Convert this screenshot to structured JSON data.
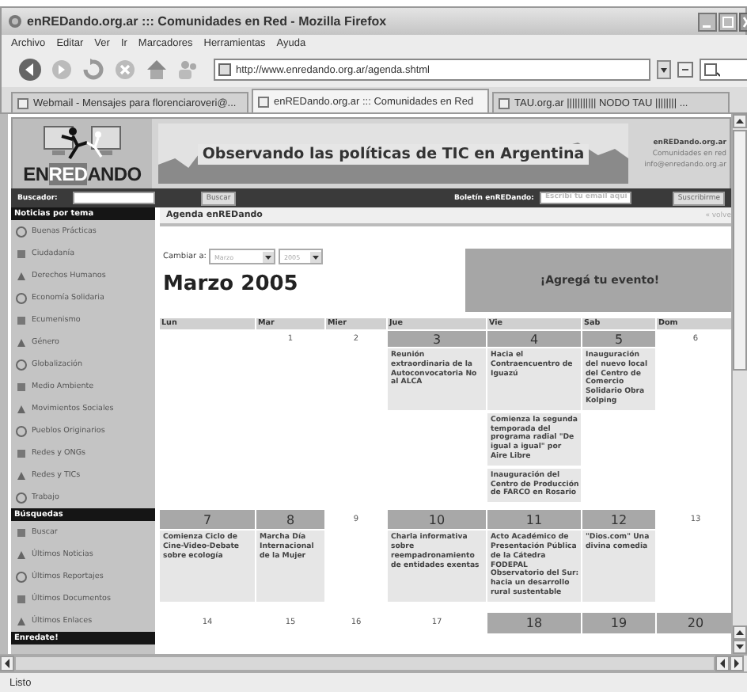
{
  "window": {
    "title": "enREDando.org.ar ::: Comunidades en Red - Mozilla Firefox"
  },
  "menu": [
    "Archivo",
    "Editar",
    "Ver",
    "Ir",
    "Marcadores",
    "Herramientas",
    "Ayuda"
  ],
  "toolbar": {
    "url": "http://www.enredando.org.ar/agenda.shtml"
  },
  "tabs": [
    {
      "label": "Webmail - Mensajes para florenciaroveri@...",
      "selected": false
    },
    {
      "label": "enREDando.org.ar ::: Comunidades en Red",
      "selected": true
    },
    {
      "label": "TAU.org.ar ||||||||||| NODO TAU |||||||| ...",
      "selected": false
    }
  ],
  "site_header": {
    "logo": [
      "EN",
      "RED",
      "ANDO"
    ],
    "banner": "Observando las políticas de TIC en Argentina",
    "info": [
      "enREDando.org.ar",
      "Comunidades en red",
      "info@enredando.org.ar"
    ]
  },
  "search_bar": {
    "search": {
      "label": "Buscador:",
      "button": "Buscar"
    },
    "newsletter": {
      "label": "Boletín enREDando:",
      "placeholder": "Escribí tu email aquí",
      "button": "Suscribirme"
    }
  },
  "sidebar": {
    "sections": [
      {
        "title": "Noticias por tema",
        "items": [
          {
            "label": "Buenas Prácticas"
          },
          {
            "label": "Ciudadanía"
          },
          {
            "label": "Derechos Humanos"
          },
          {
            "label": "Economía Solidaria"
          },
          {
            "label": "Ecumenismo"
          },
          {
            "label": "Género"
          },
          {
            "label": "Globalización"
          },
          {
            "label": "Medio Ambiente"
          },
          {
            "label": "Movimientos Sociales"
          },
          {
            "label": "Pueblos Originarios"
          },
          {
            "label": "Redes y ONGs"
          },
          {
            "label": "Redes y TICs"
          },
          {
            "label": "Trabajo"
          }
        ]
      },
      {
        "title": "Búsquedas",
        "items": [
          {
            "label": "Buscar"
          },
          {
            "label": "Últimos Noticias"
          },
          {
            "label": "Últimos Reportajes"
          },
          {
            "label": "Últimos Documentos"
          },
          {
            "label": "Últimos Enlaces"
          }
        ]
      },
      {
        "title": "Enredate!"
      }
    ]
  },
  "agenda": {
    "title": "Agenda enREDando",
    "back_link": "« volve",
    "change_label": "Cambiar a:",
    "month_select": "Marzo",
    "year_select": "2005",
    "heading": "Marzo 2005",
    "add_event": "¡Agregá tu evento!",
    "weekdays": [
      "Lun",
      "Mar",
      "Mier",
      "Jue",
      "Vie",
      "Sab",
      "Dom"
    ],
    "weeks": [
      {
        "days": [
          {
            "kind": "blank"
          },
          {
            "kind": "day",
            "day": "1",
            "highlighted": false
          },
          {
            "kind": "day",
            "day": "2",
            "highlighted": false
          },
          {
            "kind": "day",
            "day": "3",
            "highlighted": true,
            "events": [
              "Reunión extraordinaria de la Autoconvocatoria No al ALCA"
            ]
          },
          {
            "kind": "day",
            "day": "4",
            "highlighted": true,
            "events": [
              "Hacia el Contraencuentro de Iguazú",
              "Comienza la segunda temporada del programa radial \"De igual a igual\" por Aire Libre",
              "Inauguración del Centro de Producción de FARCO en Rosario"
            ]
          },
          {
            "kind": "day",
            "day": "5",
            "highlighted": true,
            "events": [
              "Inauguración del nuevo local del Centro de Comercio Solidario Obra Kolping"
            ]
          },
          {
            "kind": "day",
            "day": "6",
            "highlighted": false
          }
        ]
      },
      {
        "days": [
          {
            "kind": "day",
            "day": "7",
            "highlighted": true,
            "events": [
              "Comienza Ciclo de Cine-Video-Debate sobre ecología"
            ]
          },
          {
            "kind": "day",
            "day": "8",
            "highlighted": true,
            "events": [
              "Marcha Día Internacional de la Mujer"
            ]
          },
          {
            "kind": "day",
            "day": "9",
            "highlighted": false
          },
          {
            "kind": "day",
            "day": "10",
            "highlighted": true,
            "events": [
              "Charla informativa sobre reempadronamiento de entidades exentas"
            ]
          },
          {
            "kind": "day",
            "day": "11",
            "highlighted": true,
            "events": [
              "Acto Académico de Presentación Pública de la Cátedra FODEPAL Observatorio del Sur: hacia un desarrollo rural sustentable"
            ]
          },
          {
            "kind": "day",
            "day": "12",
            "highlighted": true,
            "events": [
              "\"Dios.com\" Una divina comedia"
            ]
          },
          {
            "kind": "day",
            "day": "13",
            "highlighted": false
          }
        ]
      },
      {
        "days": [
          {
            "kind": "day",
            "day": "14",
            "highlighted": false
          },
          {
            "kind": "day",
            "day": "15",
            "highlighted": false
          },
          {
            "kind": "day",
            "day": "16",
            "highlighted": false
          },
          {
            "kind": "day",
            "day": "17",
            "highlighted": false
          },
          {
            "kind": "day",
            "day": "18",
            "highlighted": true
          },
          {
            "kind": "day",
            "day": "19",
            "highlighted": true
          },
          {
            "kind": "day",
            "day": "20",
            "highlighted": true
          }
        ]
      }
    ]
  },
  "status_bar": "Listo"
}
